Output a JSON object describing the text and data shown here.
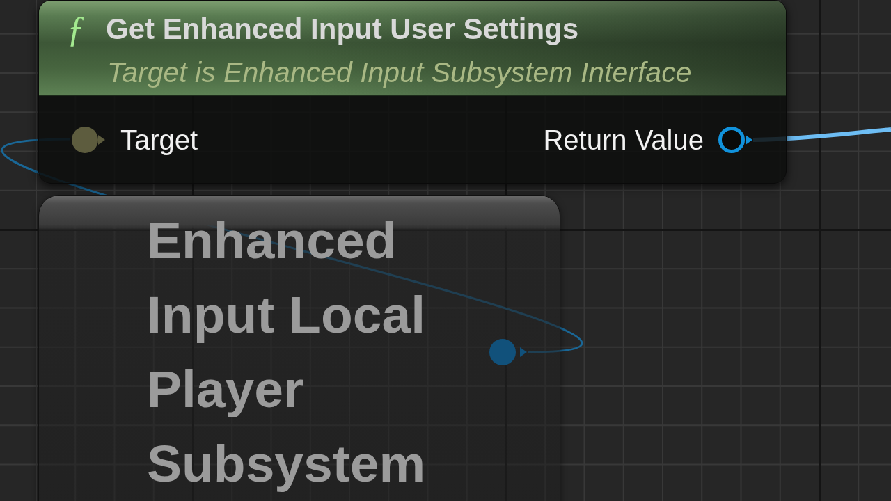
{
  "graph": {
    "nodes": [
      {
        "kind": "function",
        "symbol": "ƒ",
        "title": "Get Enhanced Input User Settings",
        "subtitle": "Target is Enhanced Input Subsystem Interface",
        "inputs": [
          {
            "label": "Target",
            "color": "#5d5c3e",
            "filled": true
          }
        ],
        "outputs": [
          {
            "label": "Return Value",
            "color": "#1192dc",
            "filled": false
          }
        ]
      },
      {
        "kind": "variable",
        "title": "Enhanced Input Local Player Subsystem",
        "outputs": [
          {
            "color": "#11517b",
            "filled": true
          }
        ]
      }
    ]
  }
}
